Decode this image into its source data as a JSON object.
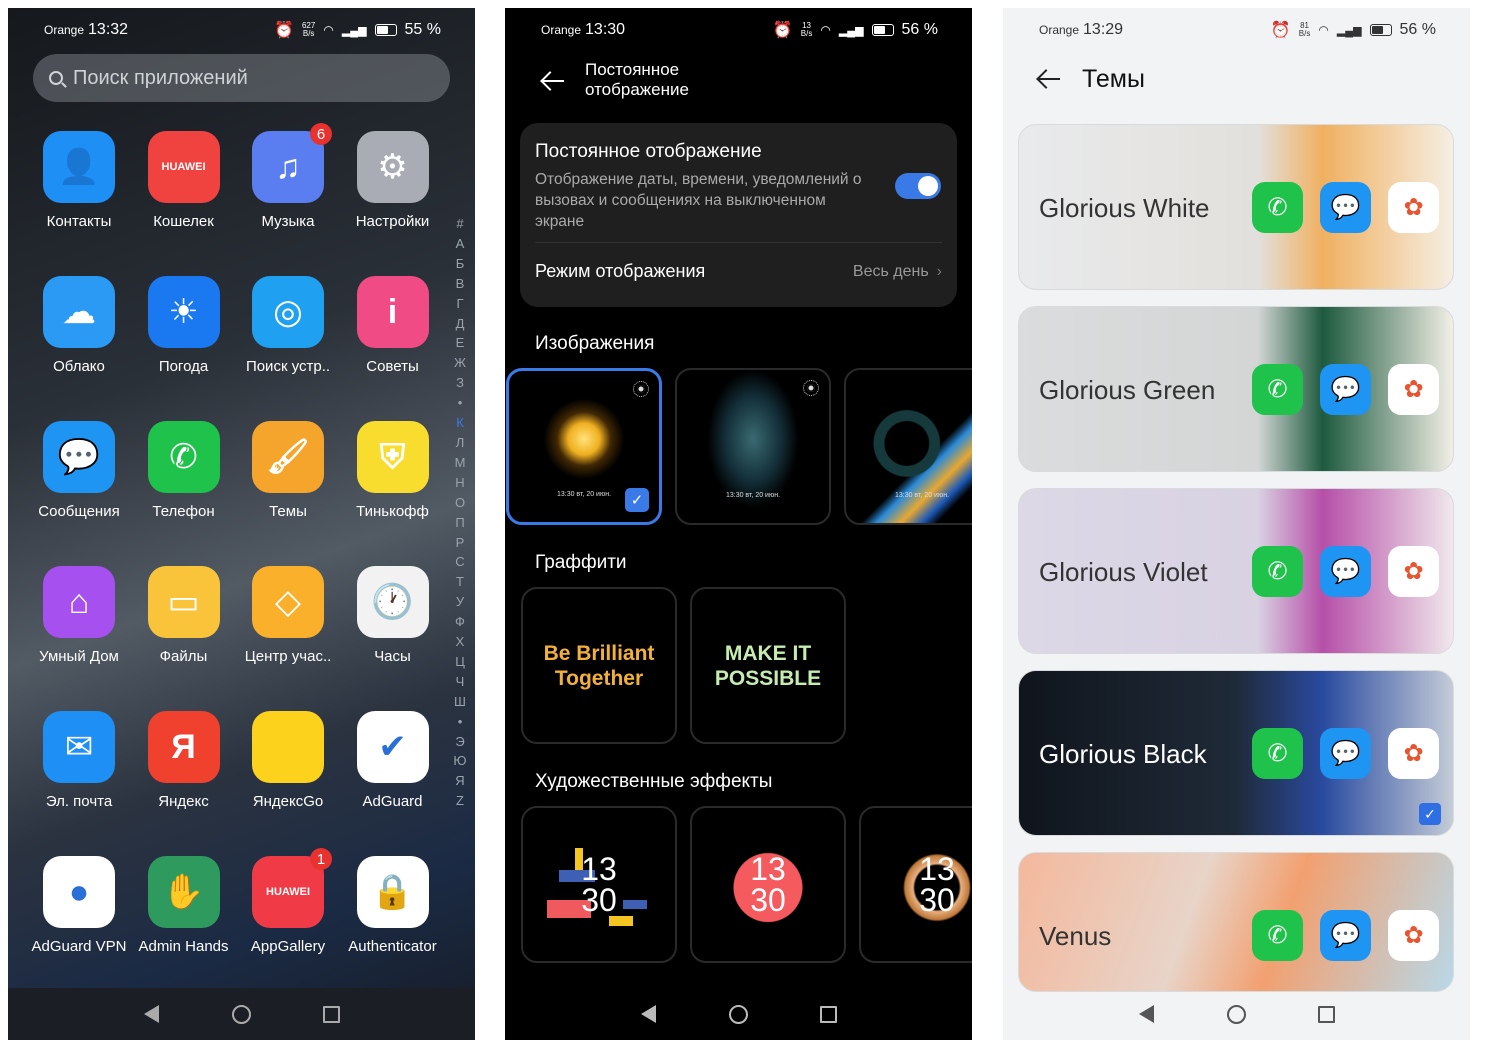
{
  "home": {
    "status": {
      "carrier": "Orange",
      "time": "13:32",
      "speed": "627",
      "speed_unit": "B/s",
      "battery": "55 %"
    },
    "search_placeholder": "Поиск приложений",
    "apps": [
      {
        "label": "Контакты",
        "icon": "contact-icon",
        "glyph": "👤",
        "bg": "#1e8ff5"
      },
      {
        "label": "Кошелек",
        "icon": "wallet-icon",
        "glyph": "HUAWEI",
        "bg": "#f0423f"
      },
      {
        "label": "Музыка",
        "icon": "music-icon",
        "glyph": "♫",
        "bg": "#5a7df0",
        "badge": "6"
      },
      {
        "label": "Настройки",
        "icon": "settings-gear-icon",
        "glyph": "⚙",
        "bg": "#a9acb4"
      },
      {
        "label": "Облако",
        "icon": "cloud-icon",
        "glyph": "☁",
        "bg": "#2a9af5"
      },
      {
        "label": "Погода",
        "icon": "weather-sun-icon",
        "glyph": "☀",
        "bg": "#1a78f0"
      },
      {
        "label": "Поиск устр..",
        "icon": "find-device-icon",
        "glyph": "◎",
        "bg": "#1fa0f0"
      },
      {
        "label": "Советы",
        "icon": "tips-icon",
        "glyph": "i",
        "bg": "#f14b86"
      },
      {
        "label": "Сообщения",
        "icon": "messages-icon",
        "glyph": "💬",
        "bg": "#1e95f2"
      },
      {
        "label": "Телефон",
        "icon": "phone-icon",
        "glyph": "✆",
        "bg": "#1fc24a"
      },
      {
        "label": "Темы",
        "icon": "themes-brush-icon",
        "glyph": "🖌",
        "bg": "#f5a52c"
      },
      {
        "label": "Тинькофф",
        "icon": "tinkoff-icon",
        "glyph": "⛨",
        "bg": "#f8dd2e"
      },
      {
        "label": "Умный Дом",
        "icon": "smart-home-icon",
        "glyph": "⌂",
        "bg": "#a650f0"
      },
      {
        "label": "Файлы",
        "icon": "files-folder-icon",
        "glyph": "▭",
        "bg": "#f9c43a"
      },
      {
        "label": "Центр учас..",
        "icon": "member-center-icon",
        "glyph": "◇",
        "bg": "#fab02a"
      },
      {
        "label": "Часы",
        "icon": "clock-icon",
        "glyph": "🕐",
        "bg": "#f2f2f2"
      },
      {
        "label": "Эл. почта",
        "icon": "email-icon",
        "glyph": "✉",
        "bg": "#1e8ff5"
      },
      {
        "label": "Яндекс",
        "icon": "yandex-icon",
        "glyph": "Я",
        "bg": "#f0402e"
      },
      {
        "label": "ЯндексGo",
        "icon": "yandex-go-icon",
        "glyph": "",
        "bg": "#fcd21d"
      },
      {
        "label": "AdGuard",
        "icon": "adguard-shield-icon",
        "glyph": "✔",
        "bg": "#ffffff"
      },
      {
        "label": "AdGuard VPN",
        "icon": "adguard-vpn-ninja-icon",
        "glyph": "●",
        "bg": "#ffffff"
      },
      {
        "label": "Admin Hands",
        "icon": "admin-hands-icon",
        "glyph": "✋",
        "bg": "#2f9a5e"
      },
      {
        "label": "AppGallery",
        "icon": "appgallery-icon",
        "glyph": "HUAWEI",
        "bg": "#f03a45",
        "badge": "1"
      },
      {
        "label": "Authenticator",
        "icon": "authenticator-lock-icon",
        "glyph": "🔒",
        "bg": "#ffffff"
      }
    ],
    "alphabet": [
      "#",
      "А",
      "Б",
      "В",
      "Г",
      "Д",
      "Е",
      "Ж",
      "З",
      "•",
      "К",
      "Л",
      "М",
      "Н",
      "О",
      "П",
      "Р",
      "С",
      "Т",
      "У",
      "Ф",
      "Х",
      "Ц",
      "Ч",
      "Ш",
      "•",
      "Э",
      "Ю",
      "Я",
      "Z"
    ],
    "alphabet_active": "К"
  },
  "aod": {
    "status": {
      "carrier": "Orange",
      "time": "13:30",
      "speed": "13",
      "speed_unit": "B/s",
      "battery": "56 %"
    },
    "title": "Постоянное отображение",
    "setting": {
      "title": "Постоянное отображение",
      "description": "Отображение даты, времени, уведомлений о вызовах и сообщениях на выключенном экране",
      "enabled": true
    },
    "mode": {
      "label": "Режим отображения",
      "value": "Весь день"
    },
    "images_title": "Изображения",
    "images": [
      {
        "caption": "13:30 вт, 20 июн.",
        "selected": true
      },
      {
        "caption": "13:30 вт, 20 июн.",
        "selected": false
      },
      {
        "caption": "13:30 вт, 20 июн.",
        "selected": false
      }
    ],
    "graffiti_title": "Граффити",
    "graffiti": [
      {
        "text": "Be Brilliant Together",
        "color": "#f3b13a"
      },
      {
        "text": "MAKE IT POSSIBLE",
        "color": "#c7ecb0"
      }
    ],
    "effects_title": "Художественные эффекты",
    "effects": [
      {
        "hours": "13",
        "minutes": "30"
      },
      {
        "hours": "13",
        "minutes": "30"
      },
      {
        "hours": "13",
        "minutes": "30"
      }
    ]
  },
  "themes": {
    "status": {
      "carrier": "Orange",
      "time": "13:29",
      "speed": "81",
      "speed_unit": "B/s",
      "battery": "56 %"
    },
    "title": "Темы",
    "items": [
      {
        "name": "Glorious White",
        "bg": "linear-gradient(90deg,#e9eaec,#e2e0dc 55%,#f0b060 70%,#f5efe4)",
        "text": "#333",
        "selected": false
      },
      {
        "name": "Glorious Green",
        "bg": "linear-gradient(90deg,#dadcdd,#d4d6d6 55%,#1d5a3e 70%,#f2efe6)",
        "text": "#333",
        "selected": false
      },
      {
        "name": "Glorious Violet",
        "bg": "linear-gradient(90deg,#dcd8e6,#d8d2e2 55%,#b64fa8 70%,#f0e8ec)",
        "text": "#333",
        "selected": false
      },
      {
        "name": "Glorious Black",
        "bg": "linear-gradient(90deg,#10151c,#1f2a38 50%,#2a4aa0 70%,#c4ccd8)",
        "text": "#fff",
        "selected": true
      },
      {
        "name": "Venus",
        "bg": "linear-gradient(110deg,#f4b89c,#e8d4c8 40%,#f2a070 60%,#b8d8e8)",
        "text": "#333",
        "selected": false
      }
    ],
    "icon_colors": {
      "phone": "#1fc24a",
      "messages": "#1e95f2",
      "gallery": "#ffffff"
    }
  },
  "nav": {
    "back": "◁",
    "home": "○",
    "recents": "□"
  }
}
